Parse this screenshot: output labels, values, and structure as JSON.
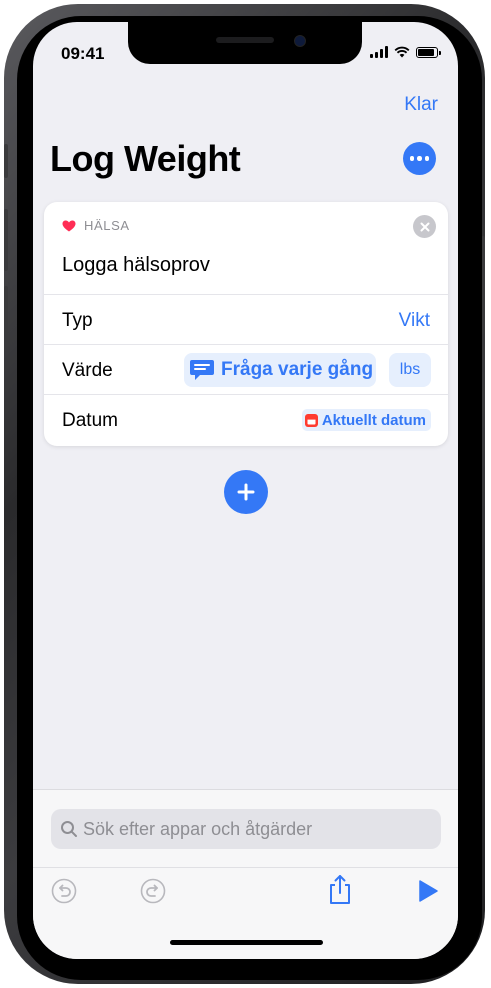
{
  "status_bar": {
    "time": "09:41"
  },
  "nav": {
    "done_label": "Klar"
  },
  "shortcut": {
    "title": "Log Weight"
  },
  "action": {
    "app_name": "HÄLSA",
    "title": "Logga hälsoprov",
    "rows": [
      {
        "label": "Typ",
        "value": "Vikt"
      },
      {
        "label": "Värde",
        "value": "Fråga varje gång",
        "unit": "lbs"
      },
      {
        "label": "Datum",
        "value": "Aktuellt datum"
      }
    ]
  },
  "search": {
    "placeholder": "Sök efter appar och åtgärder"
  },
  "colors": {
    "accent": "#3478f6",
    "background": "#efeff4",
    "health_pink": "#ff2d55",
    "calendar_red": "#ff3b30"
  },
  "icons": [
    "heart-icon",
    "close-icon",
    "more-icon",
    "chat-bubble-icon",
    "calendar-icon",
    "plus-icon",
    "search-icon",
    "undo-icon",
    "redo-icon",
    "share-icon",
    "play-icon"
  ]
}
